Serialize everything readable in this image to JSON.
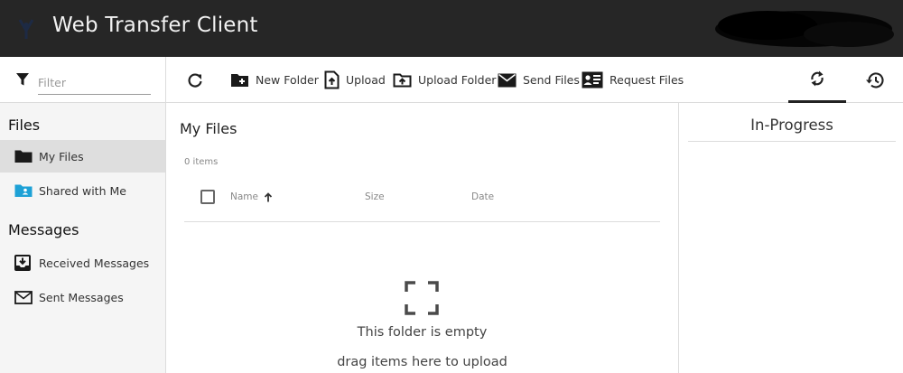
{
  "header": {
    "app_title": "Web Transfer Client"
  },
  "filter": {
    "placeholder": "Filter"
  },
  "toolbar": {
    "new_folder": "New Folder",
    "upload": "Upload",
    "upload_folder": "Upload Folder",
    "send_files": "Send Files",
    "request_files": "Request Files"
  },
  "sidebar": {
    "files_heading": "Files",
    "my_files": "My Files",
    "shared_with_me": "Shared with Me",
    "messages_heading": "Messages",
    "received_messages": "Received Messages",
    "sent_messages": "Sent Messages"
  },
  "main": {
    "title": "My Files",
    "item_count": "0 items",
    "columns": {
      "name": "Name",
      "size": "Size",
      "date": "Date"
    },
    "empty_title": "This folder is empty",
    "empty_subtitle": "drag items here to upload"
  },
  "right_panel": {
    "title": "In-Progress"
  },
  "colors": {
    "header_bg": "#262626",
    "sidebar_bg": "#f5f5f5",
    "active_item_bg": "#dedede",
    "shared_icon": "#1da1d6"
  },
  "icons": [
    "logo-icon",
    "filter-icon",
    "refresh-icon",
    "new-folder-icon",
    "upload-icon",
    "upload-folder-icon",
    "send-files-icon",
    "request-files-icon",
    "sync-icon",
    "history-icon",
    "folder-icon",
    "shared-folder-icon",
    "received-messages-icon",
    "sent-messages-icon",
    "sort-up-icon",
    "empty-frame-icon"
  ]
}
